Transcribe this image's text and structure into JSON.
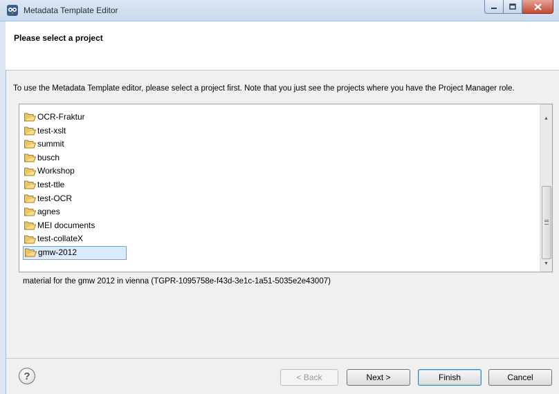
{
  "window": {
    "title": "Metadata Template Editor",
    "app_icon": "owl-icon",
    "controls": {
      "minimize_icon": "minimize-icon",
      "maximize_icon": "maximize-icon",
      "close_icon": "close-icon"
    }
  },
  "header": {
    "title": "Please select a project"
  },
  "description": "To use the Metadata Template editor, please select a project first. Note that you just see the projects where you have the Project Manager role.",
  "projects": {
    "items": [
      {
        "label": "OCR-Fraktur",
        "icon": "folder-icon"
      },
      {
        "label": "test-xslt",
        "icon": "folder-icon"
      },
      {
        "label": "summit",
        "icon": "folder-icon"
      },
      {
        "label": "busch",
        "icon": "folder-icon"
      },
      {
        "label": "Workshop",
        "icon": "folder-icon"
      },
      {
        "label": "test-ttle",
        "icon": "folder-icon"
      },
      {
        "label": "test-OCR",
        "icon": "folder-icon"
      },
      {
        "label": "agnes",
        "icon": "folder-icon"
      },
      {
        "label": "MEI documents",
        "icon": "folder-icon"
      },
      {
        "label": "test-collateX",
        "icon": "folder-icon"
      },
      {
        "label": "gmw-2012",
        "icon": "folder-icon",
        "selected": true
      }
    ],
    "selected_description": "material for the gmw 2012 in vienna (TGPR-1095758e-f43d-3e1c-1a51-5035e2e43007)"
  },
  "buttons": {
    "help_icon": "help-icon",
    "back": "< Back",
    "next": "Next >",
    "finish": "Finish",
    "cancel": "Cancel"
  },
  "colors": {
    "selection": "#dbeafd",
    "selection_border": "#7da2ce",
    "title_bar": "#dbe6f4",
    "close_button": "#c14b37"
  }
}
